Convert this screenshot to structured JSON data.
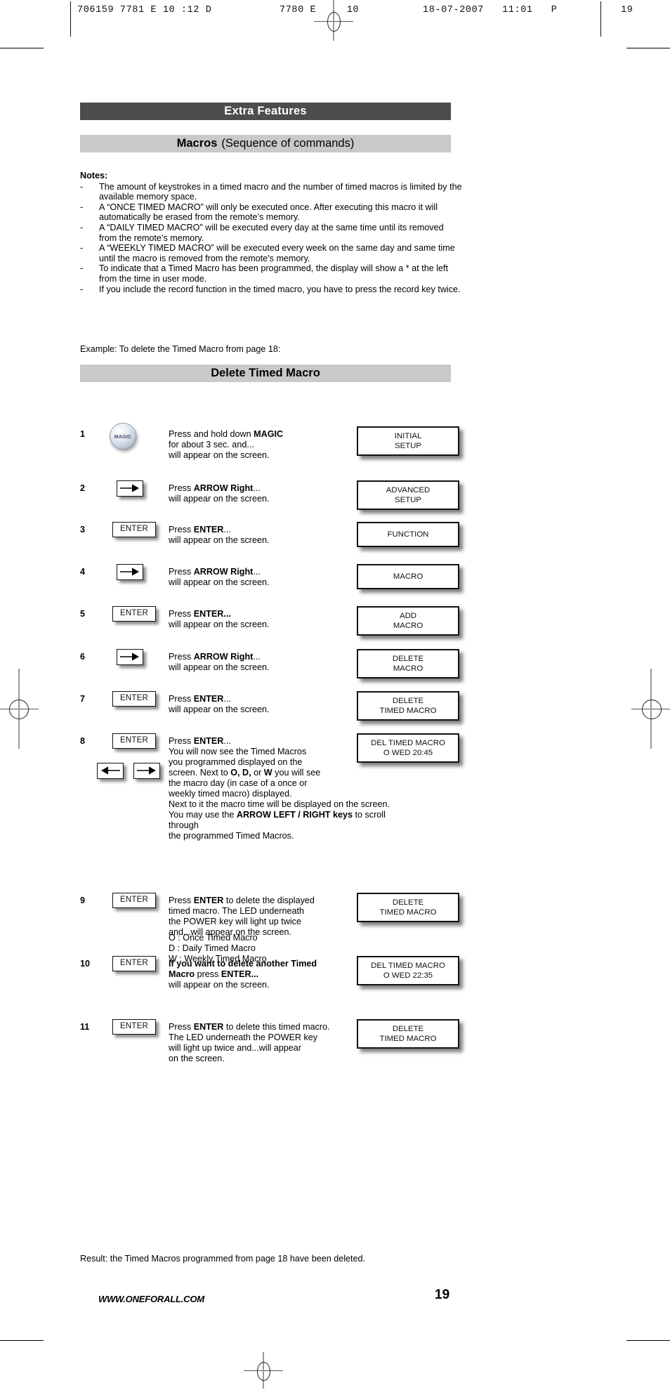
{
  "slug": {
    "left": "706159 7781 E 10 :12 D",
    "middle": "7780 E     10",
    "date": "18-07-2007   11:01   P",
    "page": "19"
  },
  "header": {
    "section_title": "Extra Features",
    "topic_bold": "Macros",
    "topic_rest": "(Sequence of commands)",
    "subsection_title": "Delete Timed Macro"
  },
  "notes": {
    "heading": "Notes:",
    "bullet_marker": "-",
    "items": [
      "The amount of keystrokes in a timed macro and the number of timed macros is limited by the available memory space.",
      "A “ONCE TIMED MACRO” will only be executed once. After executing this macro it will automatically be erased from the remote’s memory.",
      "A “DAILY TIMED MACRO” will be executed every day at the same time until its removed from the remote’s memory.",
      "A “WEEKLY TIMED MACRO” will be executed every week on the same day and same time until the macro is removed from the remote’s memory.",
      "To indicate that a Timed Macro has been programmed, the display will show a * at the left from the time in user mode.",
      "If you include the record function in the timed macro, you have to press the record key twice."
    ]
  },
  "example_line": "Example: To delete the Timed Macro from page 18:",
  "steps": [
    {
      "num": "1",
      "key_type": "magic",
      "key_label": "MAGIC",
      "lines": [
        {
          "parts": [
            {
              "t": "Press and hold down ",
              "b": false
            },
            {
              "t": "MAGIC",
              "b": true
            }
          ]
        },
        {
          "parts": [
            {
              "t": "for about 3 sec. and...",
              "b": false
            }
          ]
        },
        {
          "parts": [
            {
              "t": "will appear on the screen.",
              "b": false
            }
          ]
        }
      ],
      "display": [
        "INITIAL",
        "SETUP"
      ]
    },
    {
      "num": "2",
      "key_type": "arrow-right",
      "key_label": "arrow-right",
      "lines": [
        {
          "parts": [
            {
              "t": "Press ",
              "b": false
            },
            {
              "t": "ARROW Right",
              "b": true
            },
            {
              "t": "...",
              "b": false
            }
          ]
        },
        {
          "parts": [
            {
              "t": "will appear on the screen.",
              "b": false
            }
          ]
        }
      ],
      "display": [
        "ADVANCED",
        "SETUP"
      ]
    },
    {
      "num": "3",
      "key_type": "enter",
      "key_label": "ENTER",
      "lines": [
        {
          "parts": [
            {
              "t": "Press ",
              "b": false
            },
            {
              "t": "ENTER",
              "b": true
            },
            {
              "t": "...",
              "b": false
            }
          ]
        },
        {
          "parts": [
            {
              "t": "will appear on the screen.",
              "b": false
            }
          ]
        }
      ],
      "display": [
        "FUNCTION"
      ]
    },
    {
      "num": "4",
      "key_type": "arrow-right",
      "key_label": "arrow-right",
      "lines": [
        {
          "parts": [
            {
              "t": "Press ",
              "b": false
            },
            {
              "t": "ARROW Right",
              "b": true
            },
            {
              "t": "...",
              "b": false
            }
          ]
        },
        {
          "parts": [
            {
              "t": "will appear on the screen.",
              "b": false
            }
          ]
        }
      ],
      "display": [
        "MACRO"
      ]
    },
    {
      "num": "5",
      "key_type": "enter",
      "key_label": "ENTER",
      "lines": [
        {
          "parts": [
            {
              "t": "Press ",
              "b": false
            },
            {
              "t": "ENTER...",
              "b": true
            }
          ]
        },
        {
          "parts": [
            {
              "t": "will appear on the screen.",
              "b": false
            }
          ]
        }
      ],
      "display": [
        "ADD",
        "MACRO"
      ]
    },
    {
      "num": "6",
      "key_type": "arrow-right",
      "key_label": "arrow-right",
      "lines": [
        {
          "parts": [
            {
              "t": "Press ",
              "b": false
            },
            {
              "t": "ARROW Right",
              "b": true
            },
            {
              "t": "...",
              "b": false
            }
          ]
        },
        {
          "parts": [
            {
              "t": "will appear on the screen.",
              "b": false
            }
          ]
        }
      ],
      "display": [
        "DELETE",
        "MACRO"
      ]
    },
    {
      "num": "7",
      "key_type": "enter",
      "key_label": "ENTER",
      "lines": [
        {
          "parts": [
            {
              "t": "Press ",
              "b": false
            },
            {
              "t": "ENTER",
              "b": true
            },
            {
              "t": "...",
              "b": false
            }
          ]
        },
        {
          "parts": [
            {
              "t": "will appear on the screen.",
              "b": false
            }
          ]
        }
      ],
      "display": [
        "DELETE",
        "TIMED MACRO"
      ]
    },
    {
      "num": "8",
      "key_type": "enter-plus-arrows",
      "key_label": "ENTER",
      "lines": [
        {
          "parts": [
            {
              "t": "Press ",
              "b": false
            },
            {
              "t": "ENTER",
              "b": true
            },
            {
              "t": "...",
              "b": false
            }
          ]
        },
        {
          "parts": [
            {
              "t": "You will now see the Timed Macros",
              "b": false
            }
          ]
        },
        {
          "parts": [
            {
              "t": "you programmed displayed on the",
              "b": false
            }
          ]
        },
        {
          "parts": [
            {
              "t": "screen. Next to ",
              "b": false
            },
            {
              "t": "O, D,",
              "b": true
            },
            {
              "t": " or ",
              "b": false
            },
            {
              "t": "W",
              "b": true
            },
            {
              "t": " you will see",
              "b": false
            }
          ]
        },
        {
          "parts": [
            {
              "t": "the macro day (in case of a once or",
              "b": false
            }
          ]
        },
        {
          "parts": [
            {
              "t": "weekly timed macro) displayed.",
              "b": false
            }
          ]
        },
        {
          "parts": [
            {
              "t": "Next to it the macro time will be displayed on the screen.",
              "b": false
            }
          ]
        },
        {
          "parts": [
            {
              "t": "You may use the ",
              "b": false
            },
            {
              "t": "ARROW LEFT / RIGHT keys",
              "b": true
            },
            {
              "t": " to scroll through",
              "b": false
            }
          ]
        },
        {
          "parts": [
            {
              "t": "the programmed Timed Macros.",
              "b": false
            }
          ]
        }
      ],
      "display": [
        "DEL TIMED MACRO",
        "O WED 20:45"
      ]
    },
    {
      "num": "9",
      "key_type": "enter",
      "key_label": "ENTER",
      "lines": [
        {
          "parts": [
            {
              "t": "Press ",
              "b": false
            },
            {
              "t": "ENTER",
              "b": true
            },
            {
              "t": " to delete the displayed",
              "b": false
            }
          ]
        },
        {
          "parts": [
            {
              "t": "timed macro. The LED underneath",
              "b": false
            }
          ]
        },
        {
          "parts": [
            {
              "t": "the POWER key will light up twice",
              "b": false
            }
          ]
        },
        {
          "parts": [
            {
              "t": "and...will appear on the screen.",
              "b": false
            }
          ]
        }
      ],
      "display": [
        "DELETE",
        "TIMED MACRO"
      ]
    },
    {
      "num": "10",
      "key_type": "enter",
      "key_label": "ENTER",
      "lines": [
        {
          "parts": [
            {
              "t": "If you want to delete another Timed",
              "b": true
            }
          ]
        },
        {
          "parts": [
            {
              "t": "Macro",
              "b": true
            },
            {
              "t": " press ",
              "b": false
            },
            {
              "t": "ENTER...",
              "b": true
            }
          ]
        },
        {
          "parts": [
            {
              "t": "will appear on the screen.",
              "b": false
            }
          ]
        }
      ],
      "display": [
        "DEL TIMED MACRO",
        "O WED 22:35"
      ]
    },
    {
      "num": "11",
      "key_type": "enter",
      "key_label": "ENTER",
      "lines": [
        {
          "parts": [
            {
              "t": "Press ",
              "b": false
            },
            {
              "t": "ENTER",
              "b": true
            },
            {
              "t": " to delete this timed macro.",
              "b": false
            }
          ]
        },
        {
          "parts": [
            {
              "t": "The LED underneath the POWER key",
              "b": false
            }
          ]
        },
        {
          "parts": [
            {
              "t": "will light up twice and...will appear",
              "b": false
            }
          ]
        },
        {
          "parts": [
            {
              "t": "on the screen.",
              "b": false
            }
          ]
        }
      ],
      "display": [
        "DELETE",
        "TIMED MACRO"
      ]
    }
  ],
  "legend": [
    "O :  Once Timed Macro",
    "D :  Daily Timed Macro",
    "W :  Weekly Timed Macro"
  ],
  "result_line": "Result: the Timed Macros programmed from page 18 have been deleted.",
  "footer": {
    "url": "WWW.ONEFORALL.COM",
    "page_number": "19"
  },
  "colors": {
    "section_bar": "#4d4d4d",
    "topic_bar": "#c9c9c9",
    "text": "#000000",
    "paper": "#ffffff"
  }
}
